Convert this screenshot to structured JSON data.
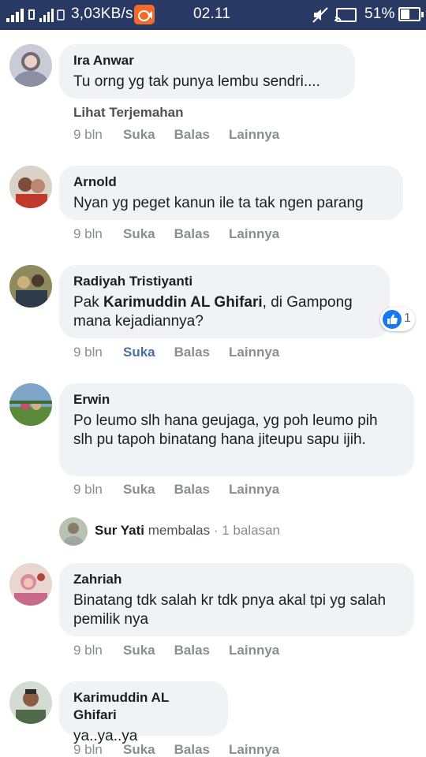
{
  "status_bar": {
    "speed": "3,03KB/s",
    "time": "02.11",
    "battery_percent": "51%",
    "battery_level": 0.51,
    "icons": [
      "signal-icon",
      "sim-slot-icon",
      "signal-2-icon",
      "screen-record-icon",
      "mute-icon",
      "cast-icon",
      "battery-icon"
    ]
  },
  "comments": [
    {
      "author": "Ira Anwar",
      "text": "Tu orng yg tak punya lembu sendri....",
      "translate_label": "Lihat Terjemahan",
      "time": "9 bln",
      "like": "Suka",
      "reply": "Balas",
      "more": "Lainnya",
      "liked": false
    },
    {
      "author": "Arnold",
      "text": "Nyan yg peget kanun ile ta tak ngen parang",
      "time": "9 bln",
      "like": "Suka",
      "reply": "Balas",
      "more": "Lainnya",
      "liked": false
    },
    {
      "author": "Radiyah Tristiyanti",
      "text_prefix": "Pak ",
      "mention": "Karimuddin AL Ghifari",
      "text_suffix": ", di Gampong mana kejadiannya?",
      "reaction_count": "1",
      "time": "9 bln",
      "like": "Suka",
      "reply": "Balas",
      "more": "Lainnya",
      "liked": true
    },
    {
      "author": "Erwin",
      "text": "Po leumo slh hana geujaga, yg poh leumo pih slh pu tapoh binatang hana jiteupu sapu ijih.",
      "time": "9 bln",
      "like": "Suka",
      "reply": "Balas",
      "more": "Lainnya",
      "liked": false
    },
    {
      "author": "Zahriah",
      "text": "Binatang tdk salah kr tdk pnya akal tpi yg salah pemilik nya",
      "time": "9 bln",
      "like": "Suka",
      "reply": "Balas",
      "more": "Lainnya",
      "liked": false
    },
    {
      "author": "Karimuddin AL Ghifari",
      "text": "ya..ya..ya",
      "time": "9 bln",
      "like": "Suka",
      "reply": "Balas",
      "more": "Lainnya",
      "liked": false
    }
  ],
  "reply_summary": {
    "name": "Sur Yati",
    "verb": " membalas",
    "separator": " · ",
    "count": "1 balasan"
  },
  "colors": {
    "status_bar": "#283963",
    "bubble": "#f0f2f5",
    "liked": "#4c6ea8",
    "muted": "#8a8d91"
  }
}
